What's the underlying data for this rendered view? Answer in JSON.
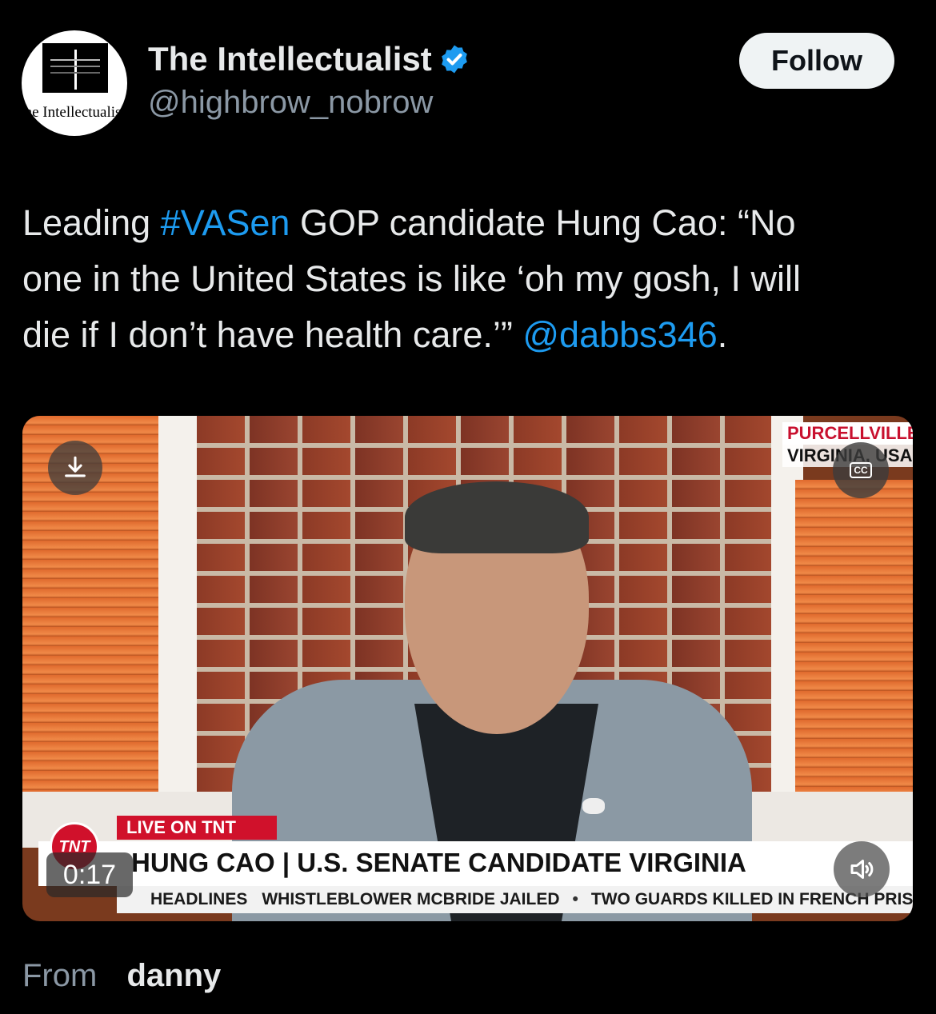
{
  "account": {
    "display_name": "The Intellectualist",
    "handle": "@highbrow_nobrow",
    "avatar_text": "The Intellectualist",
    "verified_color": "#1d9bf0"
  },
  "follow_label": "Follow",
  "tweet": {
    "line1_pre": "Leading ",
    "hashtag": "#VASen",
    "line1_post": " GOP candidate Hung Cao:   “No",
    "line2": "one in the United States is like ‘oh my gosh, I will",
    "line3_pre": "die if I don’t have health care.’” ",
    "mention": "@dabbs346",
    "line3_post": ".",
    "link_color": "#1d9bf0"
  },
  "video": {
    "location_line1": "PURCELLVILLE",
    "location_line2": "VIRGINIA, USA",
    "cc_label": "CC",
    "live_label": "LIVE ON TNT",
    "logo_text": "TNT",
    "lower_third_title": "HUNG CAO | U.S. SENATE CANDIDATE VIRGINIA",
    "ticker_label": "HEADLINES",
    "ticker_item1": "WHISTLEBLOWER MCBRIDE JAILED",
    "ticker_sep": "•",
    "ticker_item2": "TWO GUARDS KILLED IN FRENCH PRIS",
    "timestamp": "0:17",
    "icons": [
      "download-icon",
      "cc-icon",
      "volume-icon"
    ]
  },
  "footer": {
    "from_label": "From",
    "from_user": "danny"
  }
}
